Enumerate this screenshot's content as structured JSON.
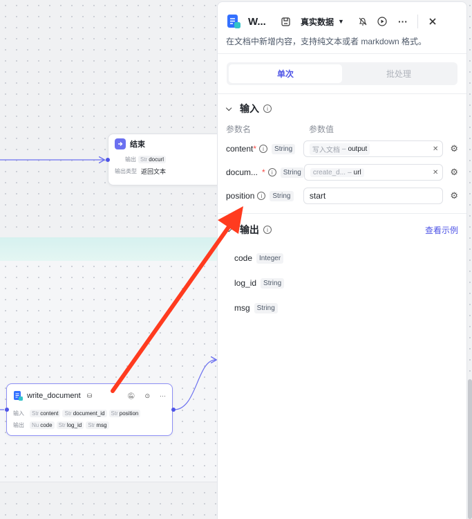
{
  "canvas": {
    "end_node": {
      "title": "结束",
      "rows": [
        {
          "label": "输出",
          "type": "Str",
          "value": "docurl"
        },
        {
          "label": "输出类型",
          "value": "返回文本"
        }
      ]
    },
    "write_node": {
      "title": "write_document",
      "input_label": "输入",
      "output_label": "输出",
      "inputs": [
        {
          "type": "Str",
          "name": "content"
        },
        {
          "type": "Str",
          "name": "document_id"
        },
        {
          "type": "Str",
          "name": "position"
        }
      ],
      "outputs": [
        {
          "type": "Nu",
          "name": "code"
        },
        {
          "type": "Str",
          "name": "log_id"
        },
        {
          "type": "Str",
          "name": "msg"
        }
      ]
    }
  },
  "panel": {
    "title": "W...",
    "data_mode": "真实数据",
    "description": "在文档中新增内容，支持纯文本或者 markdown 格式。",
    "tabs": [
      {
        "label": "单次",
        "active": true
      },
      {
        "label": "批处理",
        "active": false
      }
    ],
    "input_section": {
      "title": "输入",
      "col_name": "参数名",
      "col_value": "参数值",
      "params": [
        {
          "name": "content",
          "required": true,
          "type": "String",
          "ref_source": "写入文档",
          "ref_var": "output"
        },
        {
          "name": "docum...",
          "required": true,
          "type": "String",
          "ref_source": "create_d...",
          "ref_var": "url"
        },
        {
          "name": "position",
          "required": false,
          "type": "String",
          "value": "start"
        }
      ]
    },
    "output_section": {
      "title": "输出",
      "link": "查看示例",
      "fields": [
        {
          "name": "code",
          "type": "Integer"
        },
        {
          "name": "log_id",
          "type": "String"
        },
        {
          "name": "msg",
          "type": "String"
        }
      ]
    }
  },
  "colors": {
    "accent": "#4e54e6",
    "arrow": "#ff3b1f",
    "required": "#f54a45"
  }
}
